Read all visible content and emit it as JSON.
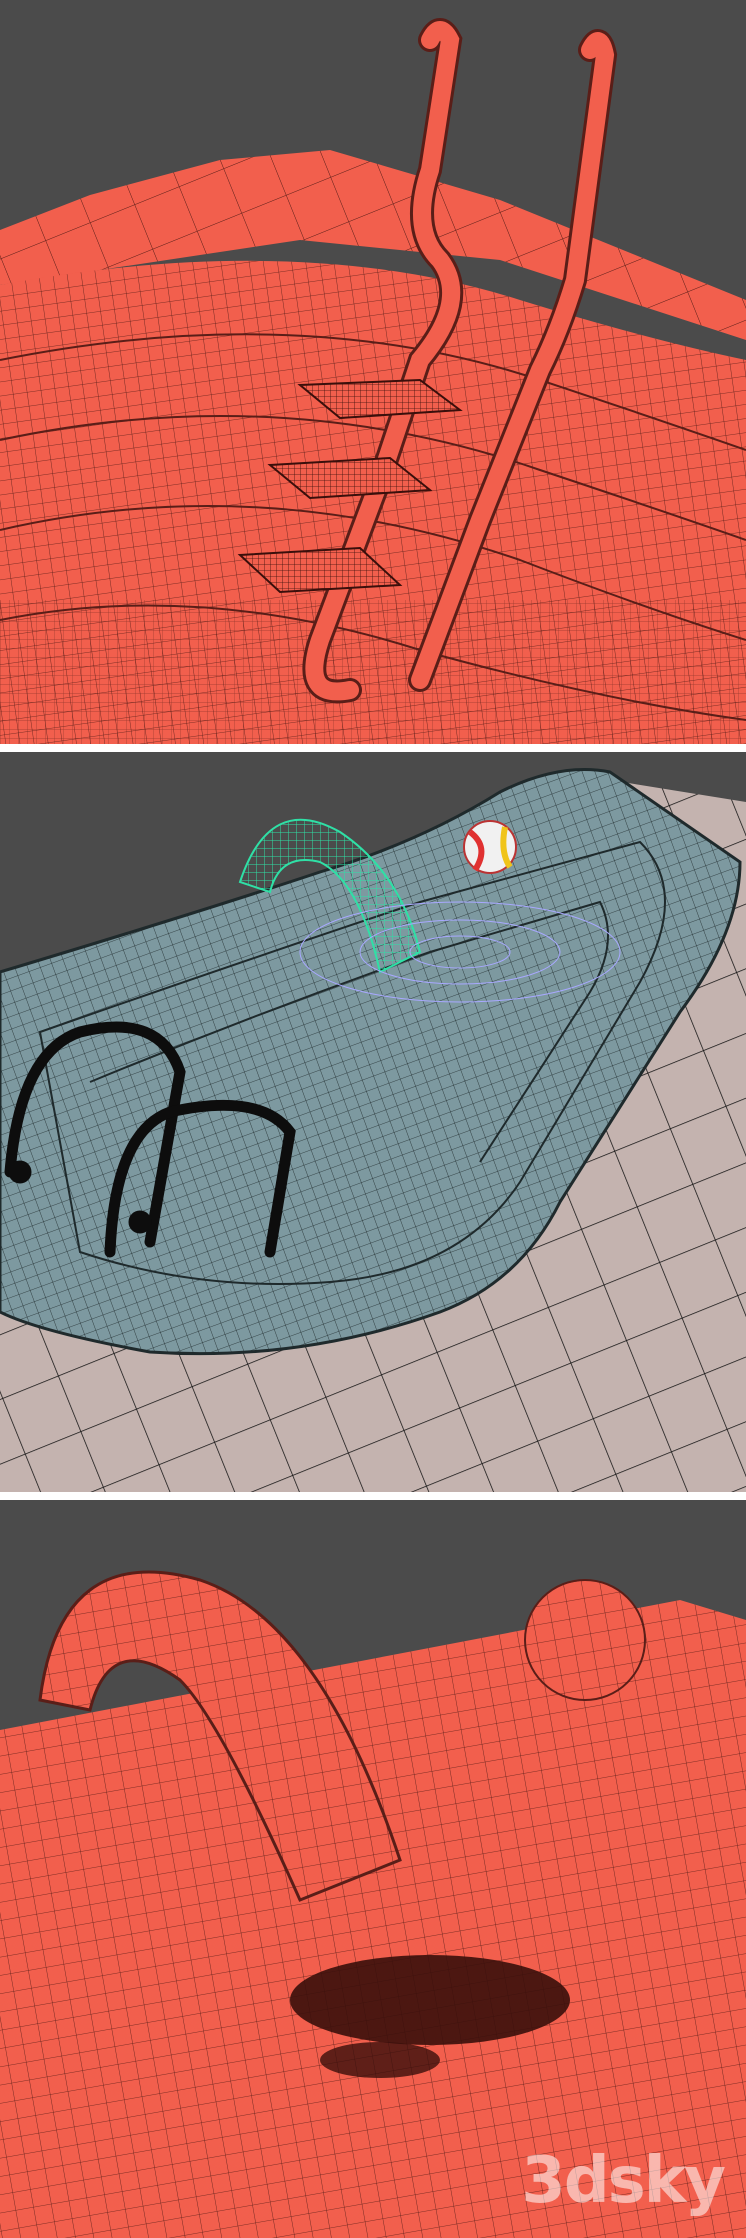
{
  "panels": [
    {
      "subject": "pool-ladder-closeup",
      "color": "#f25f4d"
    },
    {
      "subject": "pool-overview-wireframe",
      "color": "#6f8f95"
    },
    {
      "subject": "waterfall-and-ball-closeup",
      "color": "#f25f4d"
    }
  ],
  "watermark": {
    "text": "3dsky"
  },
  "colors": {
    "background": "#4b4b4b",
    "coral": "#f25f4d",
    "wire_dark": "#5a1e18",
    "pool_blue": "#7d99a0",
    "tile": "#c4b3af",
    "ladder": "#0d0d0d",
    "slide": "#2fe0a6",
    "splash": "#a8a8ff"
  }
}
